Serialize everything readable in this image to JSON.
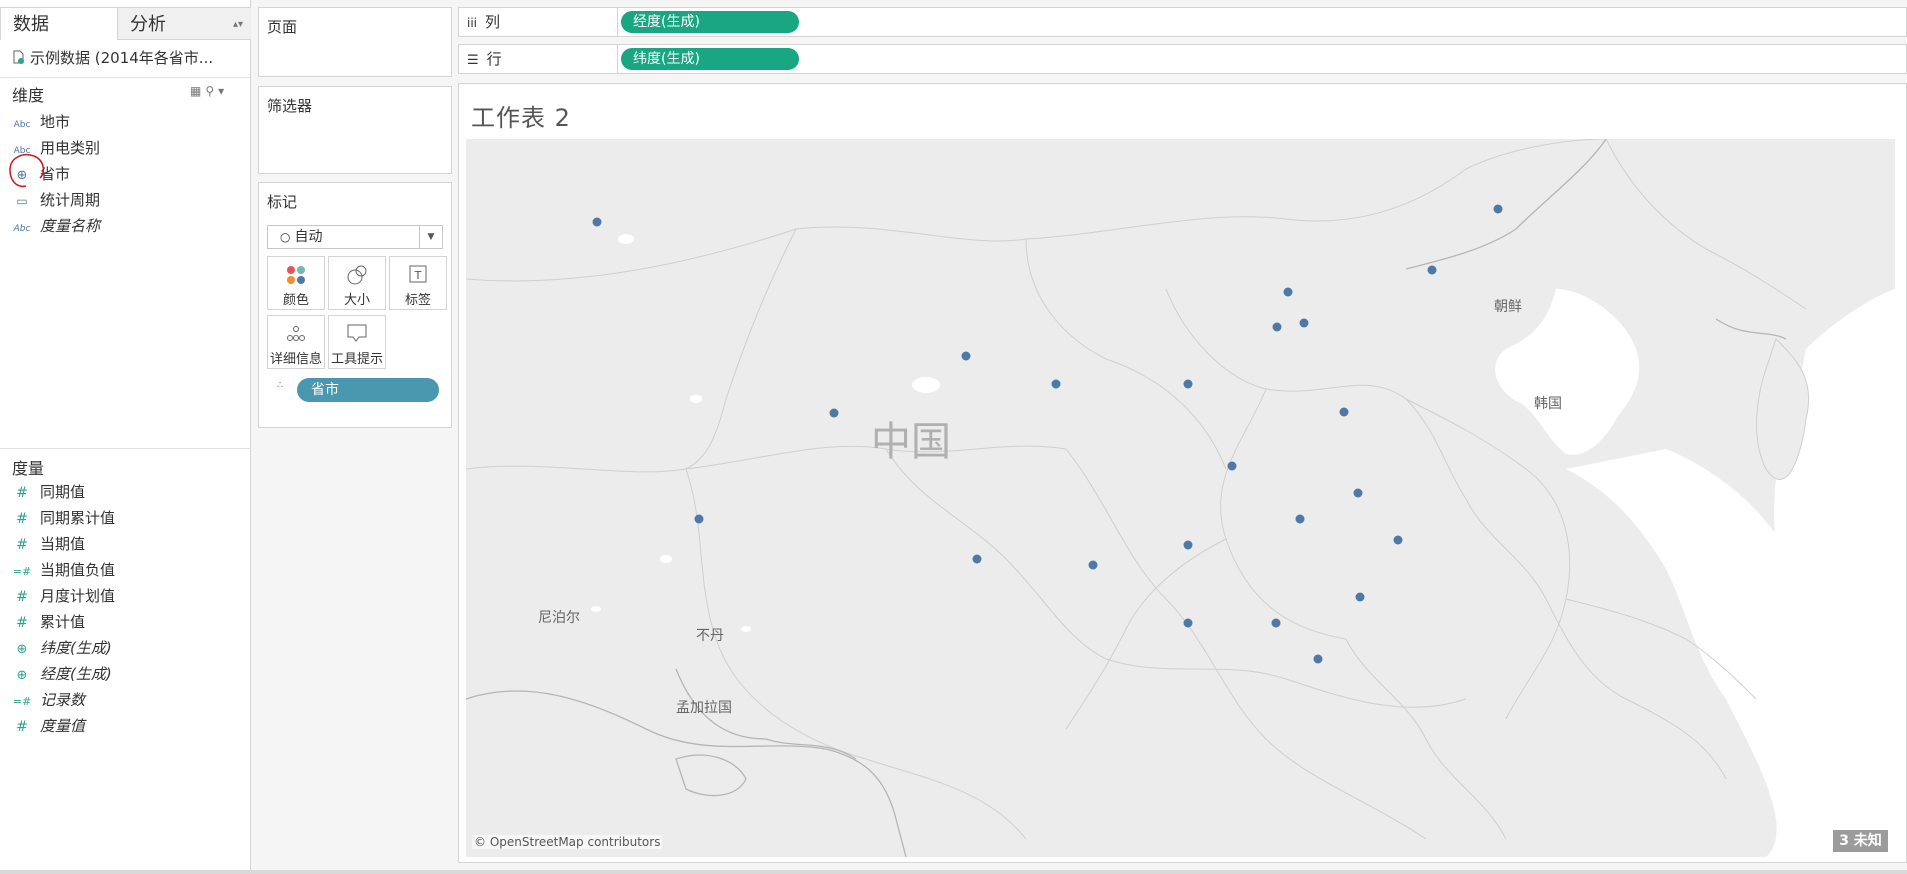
{
  "data_pane": {
    "tabs": [
      "数据",
      "分析"
    ],
    "datasource": "示例数据 (2014年各省市...",
    "dimensions_title": "维度",
    "dimensions": [
      {
        "icon": "abc-icon",
        "label": "地市",
        "italic": false
      },
      {
        "icon": "abc-icon",
        "label": "用电类别",
        "italic": false
      },
      {
        "icon": "globe-icon",
        "label": "省市",
        "italic": false
      },
      {
        "icon": "calendar-icon",
        "label": "统计周期",
        "italic": false
      },
      {
        "icon": "abc-icon",
        "label": "度量名称",
        "italic": true
      }
    ],
    "measures_title": "度量",
    "measures": [
      {
        "icon": "hash-icon",
        "label": "同期值",
        "italic": false
      },
      {
        "icon": "hash-icon",
        "label": "同期累计值",
        "italic": false
      },
      {
        "icon": "hash-icon",
        "label": "当期值",
        "italic": false
      },
      {
        "icon": "calc-hash-icon",
        "label": "当期值负值",
        "italic": false
      },
      {
        "icon": "hash-icon",
        "label": "月度计划值",
        "italic": false
      },
      {
        "icon": "hash-icon",
        "label": "累计值",
        "italic": false
      },
      {
        "icon": "globe-icon",
        "label": "纬度(生成)",
        "italic": true
      },
      {
        "icon": "globe-icon",
        "label": "经度(生成)",
        "italic": true
      },
      {
        "icon": "calc-hash-icon",
        "label": "记录数",
        "italic": true
      },
      {
        "icon": "hash-icon",
        "label": "度量值",
        "italic": true
      }
    ]
  },
  "cards": {
    "pages": "页面",
    "filters": "筛选器",
    "marks": "标记",
    "mark_type": "自动",
    "mark_buttons": [
      "颜色",
      "大小",
      "标签",
      "详细信息",
      "工具提示"
    ],
    "detail_pill": "省市"
  },
  "shelves": {
    "columns_label": "列",
    "columns_pill": "经度(生成)",
    "rows_label": "行",
    "rows_pill": "纬度(生成)"
  },
  "view": {
    "title": "工作表 2",
    "country_labels": [
      "中国",
      "朝鲜",
      "韩国",
      "尼泊尔",
      "不丹",
      "孟加拉国"
    ],
    "attribution": "© OpenStreetMap contributors",
    "unknown_badge": "3 未知",
    "mark_color": "#4e79a7"
  },
  "colors": {
    "pill_green": "#18a683",
    "pill_blue": "#4a97b0"
  }
}
